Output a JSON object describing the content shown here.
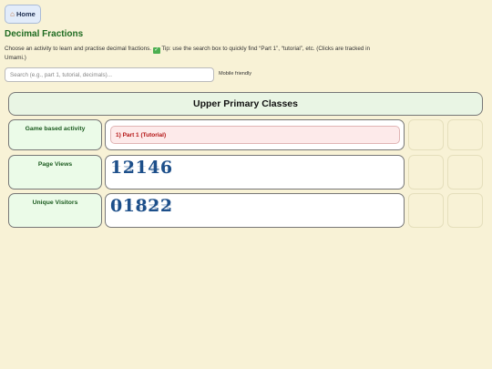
{
  "nav": {
    "home_label": "Home",
    "home_icon": "house-icon"
  },
  "page": {
    "title": "Decimal Fractions",
    "intro_text": "Choose an activity to learn and practise decimal fractions.",
    "tip_text": "Tip: use the search box to quickly find “Part 1”, “tutorial”, etc. (Clicks are tracked in Umami.)"
  },
  "search": {
    "placeholder": "Search (e.g., part 1, tutorial, decimals)...",
    "value": ""
  },
  "mobile_label": "Mobile friendly",
  "table": {
    "header": "Upper Primary Classes",
    "rows": [
      {
        "label": "Game based activity",
        "activity": "1) Part 1 (Tutorial)"
      },
      {
        "label": "Page Views",
        "counter": "12146"
      },
      {
        "label": "Unique Visitors",
        "counter": "01822"
      }
    ]
  },
  "colors": {
    "background": "#f8f2d6",
    "title_green": "#1f6b21",
    "activity_red": "#b41414",
    "counter_blue": "#1d4f8a"
  }
}
